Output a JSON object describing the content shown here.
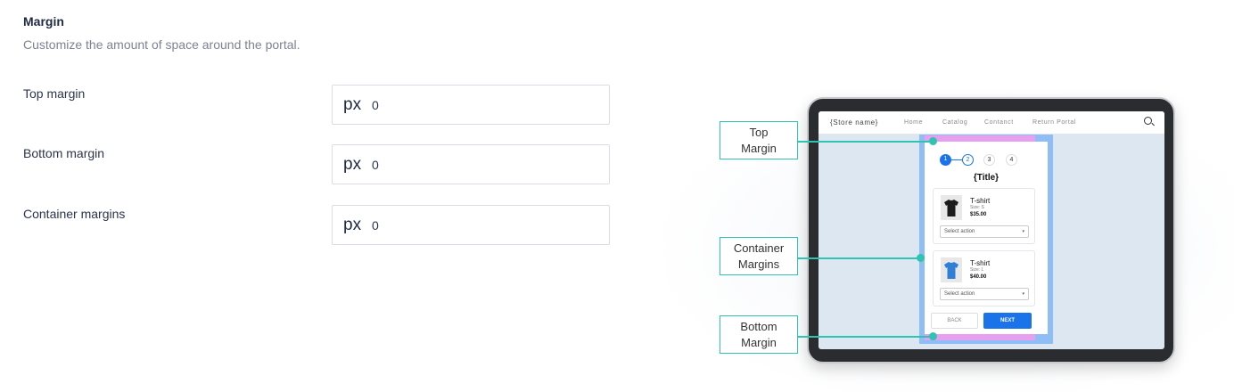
{
  "section": {
    "title": "Margin",
    "description": "Customize the amount of space around the portal."
  },
  "fields": [
    {
      "label": "Top margin",
      "unit": "px",
      "value": "0"
    },
    {
      "label": "Bottom margin",
      "unit": "px",
      "value": "0"
    },
    {
      "label": "Container margins",
      "unit": "px",
      "value": "0"
    }
  ],
  "illustration": {
    "nav": {
      "store": "{Store name}",
      "home": "Home",
      "catalog": "Catalog",
      "contact": "Contanct",
      "return_portal": "Return Portal"
    },
    "steps": [
      "1",
      "2",
      "3",
      "4"
    ],
    "portal_title": "{Title}",
    "products": [
      {
        "name": "T-shirt",
        "size": "Size: S",
        "price": "$35.00",
        "select": "Select action",
        "color": "#1c1c1c"
      },
      {
        "name": "T-shirt",
        "size": "Size: L",
        "price": "$40.00",
        "select": "Select action",
        "color": "#2f7fd8"
      }
    ],
    "back_label": "BACK",
    "next_label": "NEXT",
    "callouts": {
      "top": [
        "Top",
        "Margin"
      ],
      "container": [
        "Container",
        "Margins"
      ],
      "bottom": [
        "Bottom",
        "Margin"
      ]
    }
  },
  "colors": {
    "accent": "#1a73e8",
    "callout": "#2fc4b2",
    "margin_highlight": "#e79ff0",
    "container_highlight": "#8fbdf5"
  }
}
